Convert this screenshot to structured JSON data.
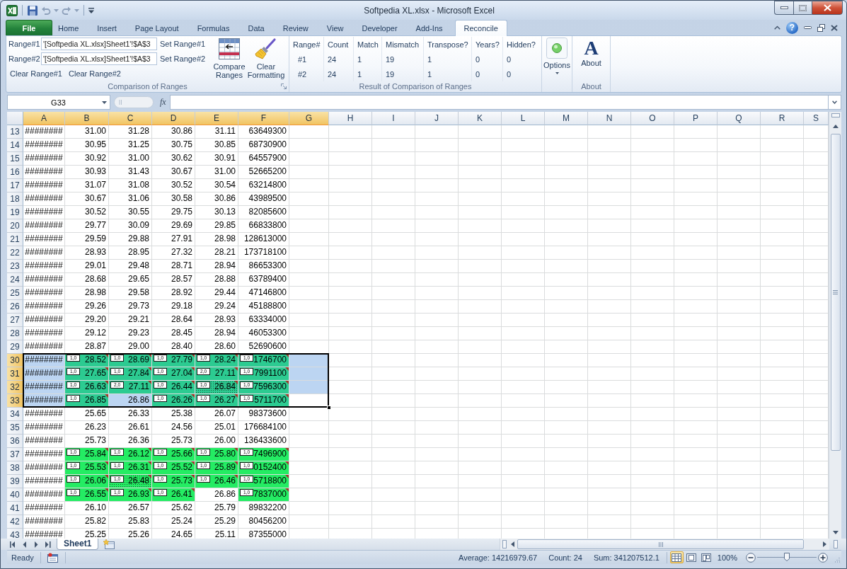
{
  "window": {
    "title": "Softpedia XL.xlsx - Microsoft Excel"
  },
  "ribbon_tabs": [
    {
      "label": "File",
      "kind": "file",
      "selected": false
    },
    {
      "label": "Home",
      "kind": "tab",
      "selected": false
    },
    {
      "label": "Insert",
      "kind": "tab",
      "selected": false
    },
    {
      "label": "Page Layout",
      "kind": "tab",
      "selected": false
    },
    {
      "label": "Formulas",
      "kind": "tab",
      "selected": false
    },
    {
      "label": "Data",
      "kind": "tab",
      "selected": false
    },
    {
      "label": "Review",
      "kind": "tab",
      "selected": false
    },
    {
      "label": "View",
      "kind": "tab",
      "selected": false
    },
    {
      "label": "Developer",
      "kind": "tab",
      "selected": false
    },
    {
      "label": "Add-Ins",
      "kind": "tab",
      "selected": false
    },
    {
      "label": "Reconcile",
      "kind": "tab",
      "selected": true
    }
  ],
  "ribbon_controls": {
    "help": "?"
  },
  "ribbon": {
    "comparison": {
      "title": "Comparison of Ranges",
      "ranges": [
        {
          "label": "Range#1",
          "value": "'[Softpedia XL.xlsx]Sheet1'!$A$3",
          "button": "Set Range#1"
        },
        {
          "label": "Range#2",
          "value": "'[Softpedia XL.xlsx]Sheet1'!$A$3",
          "button": "Set Range#2"
        }
      ],
      "clear_buttons": [
        "Clear Range#1",
        "Clear Range#2"
      ],
      "large_buttons": [
        {
          "kind": "compare",
          "label": "Compare Ranges"
        },
        {
          "kind": "clear",
          "label": "Clear Formatting"
        }
      ]
    },
    "results": {
      "title": "Result of Comparison of Ranges",
      "columns": [
        "Range#",
        "Count",
        "Match",
        "Mismatch",
        "Transpose?",
        "Years?",
        "Hidden?"
      ],
      "rows": [
        [
          "#1",
          "24",
          "1",
          "19",
          "1",
          "0",
          "0"
        ],
        [
          "#2",
          "24",
          "1",
          "19",
          "1",
          "0",
          "0"
        ]
      ]
    },
    "options": {
      "label": "Options"
    },
    "about": {
      "glyph": "A",
      "label": "About",
      "title": "About"
    }
  },
  "formula_bar": {
    "name_box": "G33",
    "function_button": "fx"
  },
  "sheet": {
    "columns": [
      {
        "label": "A",
        "selected": true
      },
      {
        "label": "B",
        "selected": true
      },
      {
        "label": "C",
        "selected": true
      },
      {
        "label": "D",
        "selected": true
      },
      {
        "label": "E",
        "selected": true
      },
      {
        "label": "F",
        "selected": true
      },
      {
        "label": "G",
        "selected": true
      },
      {
        "label": "H",
        "selected": false
      },
      {
        "label": "I",
        "selected": false
      },
      {
        "label": "J",
        "selected": false
      },
      {
        "label": "K",
        "selected": false
      },
      {
        "label": "L",
        "selected": false
      },
      {
        "label": "M",
        "selected": false
      },
      {
        "label": "N",
        "selected": false
      },
      {
        "label": "O",
        "selected": false
      },
      {
        "label": "P",
        "selected": false
      },
      {
        "label": "Q",
        "selected": false
      },
      {
        "label": "R",
        "selected": false
      },
      {
        "label": "S",
        "selected": false
      }
    ],
    "rows": [
      {
        "number": "13",
        "selected": false,
        "cells": [
          {
            "text": "########",
            "active": false,
            "dotted": false
          },
          {
            "text": "31.00",
            "active": false,
            "dotted": false
          },
          {
            "text": "31.28",
            "active": false,
            "dotted": false
          },
          {
            "text": "30.86",
            "active": false,
            "dotted": false
          },
          {
            "text": "31.11",
            "active": false,
            "dotted": false
          },
          {
            "text": "63649300",
            "active": false,
            "dotted": false
          }
        ]
      },
      {
        "number": "14",
        "selected": false,
        "cells": [
          {
            "text": "########",
            "active": false,
            "dotted": false
          },
          {
            "text": "30.95",
            "active": false,
            "dotted": false
          },
          {
            "text": "31.25",
            "active": false,
            "dotted": false
          },
          {
            "text": "30.75",
            "active": false,
            "dotted": false
          },
          {
            "text": "30.85",
            "active": false,
            "dotted": false
          },
          {
            "text": "68730900",
            "active": false,
            "dotted": false
          }
        ]
      },
      {
        "number": "15",
        "selected": false,
        "cells": [
          {
            "text": "########",
            "active": false,
            "dotted": false
          },
          {
            "text": "30.92",
            "active": false,
            "dotted": false
          },
          {
            "text": "31.00",
            "active": false,
            "dotted": false
          },
          {
            "text": "30.62",
            "active": false,
            "dotted": false
          },
          {
            "text": "30.91",
            "active": false,
            "dotted": false
          },
          {
            "text": "64557900",
            "active": false,
            "dotted": false
          }
        ]
      },
      {
        "number": "16",
        "selected": false,
        "cells": [
          {
            "text": "########",
            "active": false,
            "dotted": false
          },
          {
            "text": "30.93",
            "active": false,
            "dotted": false
          },
          {
            "text": "31.43",
            "active": false,
            "dotted": false
          },
          {
            "text": "30.67",
            "active": false,
            "dotted": false
          },
          {
            "text": "31.00",
            "active": false,
            "dotted": false
          },
          {
            "text": "52665200",
            "active": false,
            "dotted": false
          }
        ]
      },
      {
        "number": "17",
        "selected": false,
        "cells": [
          {
            "text": "########",
            "active": false,
            "dotted": false
          },
          {
            "text": "31.07",
            "active": false,
            "dotted": false
          },
          {
            "text": "31.08",
            "active": false,
            "dotted": false
          },
          {
            "text": "30.52",
            "active": false,
            "dotted": false
          },
          {
            "text": "30.54",
            "active": false,
            "dotted": false
          },
          {
            "text": "63214800",
            "active": false,
            "dotted": false
          }
        ]
      },
      {
        "number": "18",
        "selected": false,
        "cells": [
          {
            "text": "########",
            "active": false,
            "dotted": false
          },
          {
            "text": "30.67",
            "active": false,
            "dotted": false
          },
          {
            "text": "31.06",
            "active": false,
            "dotted": false
          },
          {
            "text": "30.58",
            "active": false,
            "dotted": false
          },
          {
            "text": "30.86",
            "active": false,
            "dotted": false
          },
          {
            "text": "43989500",
            "active": false,
            "dotted": false
          }
        ]
      },
      {
        "number": "19",
        "selected": false,
        "cells": [
          {
            "text": "########",
            "active": false,
            "dotted": false
          },
          {
            "text": "30.52",
            "active": false,
            "dotted": false
          },
          {
            "text": "30.55",
            "active": false,
            "dotted": false
          },
          {
            "text": "29.75",
            "active": false,
            "dotted": false
          },
          {
            "text": "30.13",
            "active": false,
            "dotted": false
          },
          {
            "text": "82085600",
            "active": false,
            "dotted": false
          }
        ]
      },
      {
        "number": "20",
        "selected": false,
        "cells": [
          {
            "text": "########",
            "active": false,
            "dotted": false
          },
          {
            "text": "29.77",
            "active": false,
            "dotted": false
          },
          {
            "text": "30.09",
            "active": false,
            "dotted": false
          },
          {
            "text": "29.69",
            "active": false,
            "dotted": false
          },
          {
            "text": "29.85",
            "active": false,
            "dotted": false
          },
          {
            "text": "66833800",
            "active": false,
            "dotted": false
          }
        ]
      },
      {
        "number": "21",
        "selected": false,
        "cells": [
          {
            "text": "########",
            "active": false,
            "dotted": false
          },
          {
            "text": "29.59",
            "active": false,
            "dotted": false
          },
          {
            "text": "29.88",
            "active": false,
            "dotted": false
          },
          {
            "text": "27.91",
            "active": false,
            "dotted": false
          },
          {
            "text": "28.98",
            "active": false,
            "dotted": false
          },
          {
            "text": "128613000",
            "active": false,
            "dotted": false
          }
        ]
      },
      {
        "number": "22",
        "selected": false,
        "cells": [
          {
            "text": "########",
            "active": false,
            "dotted": false
          },
          {
            "text": "28.93",
            "active": false,
            "dotted": false
          },
          {
            "text": "28.95",
            "active": false,
            "dotted": false
          },
          {
            "text": "27.32",
            "active": false,
            "dotted": false
          },
          {
            "text": "28.21",
            "active": false,
            "dotted": false
          },
          {
            "text": "173718100",
            "active": false,
            "dotted": false
          }
        ]
      },
      {
        "number": "23",
        "selected": false,
        "cells": [
          {
            "text": "########",
            "active": false,
            "dotted": false
          },
          {
            "text": "29.01",
            "active": false,
            "dotted": false
          },
          {
            "text": "29.48",
            "active": false,
            "dotted": false
          },
          {
            "text": "28.71",
            "active": false,
            "dotted": false
          },
          {
            "text": "28.94",
            "active": false,
            "dotted": false
          },
          {
            "text": "86653300",
            "active": false,
            "dotted": false
          }
        ]
      },
      {
        "number": "24",
        "selected": false,
        "cells": [
          {
            "text": "########",
            "active": false,
            "dotted": false
          },
          {
            "text": "28.68",
            "active": false,
            "dotted": false
          },
          {
            "text": "29.65",
            "active": false,
            "dotted": false
          },
          {
            "text": "28.57",
            "active": false,
            "dotted": false
          },
          {
            "text": "28.88",
            "active": false,
            "dotted": false
          },
          {
            "text": "63789400",
            "active": false,
            "dotted": false
          }
        ]
      },
      {
        "number": "25",
        "selected": false,
        "cells": [
          {
            "text": "########",
            "active": false,
            "dotted": false
          },
          {
            "text": "28.98",
            "active": false,
            "dotted": false
          },
          {
            "text": "29.58",
            "active": false,
            "dotted": false
          },
          {
            "text": "28.92",
            "active": false,
            "dotted": false
          },
          {
            "text": "29.44",
            "active": false,
            "dotted": false
          },
          {
            "text": "47146800",
            "active": false,
            "dotted": false
          }
        ]
      },
      {
        "number": "26",
        "selected": false,
        "cells": [
          {
            "text": "########",
            "active": false,
            "dotted": false
          },
          {
            "text": "29.26",
            "active": false,
            "dotted": false
          },
          {
            "text": "29.73",
            "active": false,
            "dotted": false
          },
          {
            "text": "29.18",
            "active": false,
            "dotted": false
          },
          {
            "text": "29.24",
            "active": false,
            "dotted": false
          },
          {
            "text": "45188800",
            "active": false,
            "dotted": false
          }
        ]
      },
      {
        "number": "27",
        "selected": false,
        "cells": [
          {
            "text": "########",
            "active": false,
            "dotted": false
          },
          {
            "text": "29.20",
            "active": false,
            "dotted": false
          },
          {
            "text": "29.21",
            "active": false,
            "dotted": false
          },
          {
            "text": "28.64",
            "active": false,
            "dotted": false
          },
          {
            "text": "28.93",
            "active": false,
            "dotted": false
          },
          {
            "text": "63334000",
            "active": false,
            "dotted": false
          }
        ]
      },
      {
        "number": "28",
        "selected": false,
        "cells": [
          {
            "text": "########",
            "active": false,
            "dotted": false
          },
          {
            "text": "29.12",
            "active": false,
            "dotted": false
          },
          {
            "text": "29.23",
            "active": false,
            "dotted": false
          },
          {
            "text": "28.45",
            "active": false,
            "dotted": false
          },
          {
            "text": "28.94",
            "active": false,
            "dotted": false
          },
          {
            "text": "46053300",
            "active": false,
            "dotted": false
          }
        ]
      },
      {
        "number": "29",
        "selected": false,
        "cells": [
          {
            "text": "########",
            "active": false,
            "dotted": false
          },
          {
            "text": "28.87",
            "active": false,
            "dotted": false
          },
          {
            "text": "29.00",
            "active": false,
            "dotted": false
          },
          {
            "text": "28.40",
            "active": false,
            "dotted": false
          },
          {
            "text": "28.60",
            "active": false,
            "dotted": false
          },
          {
            "text": "52690600",
            "active": false,
            "dotted": false
          }
        ]
      },
      {
        "number": "30",
        "selected": true,
        "cells": [
          {
            "text": "########",
            "active": false,
            "dotted": false
          },
          {
            "text": "28.52",
            "active": false,
            "dotted": false,
            "color": "#2ccb91",
            "note": "1,0"
          },
          {
            "text": "28.69",
            "active": false,
            "dotted": false,
            "color": "#2ccb91",
            "note": "1,0"
          },
          {
            "text": "27.79",
            "active": false,
            "dotted": false,
            "color": "#2ccb91",
            "note": "1,0"
          },
          {
            "text": "28.24",
            "active": false,
            "dotted": false,
            "color": "#2ccb91",
            "note": "1,0"
          },
          {
            "text": "1746700",
            "active": false,
            "dotted": false,
            "color": "#2ccb91",
            "note": "1,0"
          },
          {
            "active": false,
            "dotted": false
          }
        ]
      },
      {
        "number": "31",
        "selected": true,
        "cells": [
          {
            "text": "########",
            "active": false,
            "dotted": false
          },
          {
            "text": "27.65",
            "active": false,
            "dotted": false,
            "color": "#2ccb91",
            "note": "1,0"
          },
          {
            "text": "27.84",
            "active": false,
            "dotted": false,
            "color": "#2ccb91",
            "note": "1,0"
          },
          {
            "text": "27.04",
            "active": false,
            "dotted": false,
            "color": "#2ccb91",
            "note": "1,0"
          },
          {
            "text": "27.11",
            "active": false,
            "dotted": false,
            "color": "#2ccb91",
            "note": "2,0"
          },
          {
            "text": "7991100",
            "active": false,
            "dotted": false,
            "color": "#2ccb91",
            "note": "1,0"
          },
          {
            "active": false,
            "dotted": false
          }
        ]
      },
      {
        "number": "32",
        "selected": true,
        "cells": [
          {
            "text": "########",
            "active": false,
            "dotted": false
          },
          {
            "text": "26.63",
            "active": false,
            "dotted": false,
            "color": "#2ccb91",
            "note": "1,0"
          },
          {
            "text": "27.11",
            "active": false,
            "dotted": false,
            "color": "#2ccb91",
            "note": "2,0"
          },
          {
            "text": "26.44",
            "active": false,
            "dotted": false,
            "color": "#2ccb91",
            "note": "1,0"
          },
          {
            "text": "26.84",
            "active": false,
            "dotted": true,
            "color": "#2ccb91",
            "note": "1,0"
          },
          {
            "text": "7596300",
            "active": false,
            "dotted": false,
            "color": "#2ccb91",
            "note": "1,0"
          },
          {
            "active": false,
            "dotted": false
          }
        ]
      },
      {
        "number": "33",
        "selected": true,
        "cells": [
          {
            "text": "########",
            "active": false,
            "dotted": false
          },
          {
            "text": "26.85",
            "active": false,
            "dotted": false,
            "color": "#2ccb91",
            "note": "1,0"
          },
          {
            "text": "26.86",
            "active": false,
            "dotted": false
          },
          {
            "text": "26.26",
            "active": false,
            "dotted": false,
            "color": "#2ccb91",
            "note": "1,0"
          },
          {
            "text": "26.27",
            "active": false,
            "dotted": false,
            "color": "#2ccb91",
            "note": "1,0"
          },
          {
            "text": "5711700",
            "active": false,
            "dotted": false,
            "color": "#2ccb91",
            "note": "1,0"
          },
          {
            "active": true,
            "dotted": false
          }
        ]
      },
      {
        "number": "34",
        "selected": false,
        "cells": [
          {
            "text": "########",
            "active": false,
            "dotted": false
          },
          {
            "text": "25.65",
            "active": false,
            "dotted": false
          },
          {
            "text": "26.33",
            "active": false,
            "dotted": false
          },
          {
            "text": "25.38",
            "active": false,
            "dotted": false
          },
          {
            "text": "26.07",
            "active": false,
            "dotted": false
          },
          {
            "text": "98373600",
            "active": false,
            "dotted": false
          }
        ]
      },
      {
        "number": "35",
        "selected": false,
        "cells": [
          {
            "text": "########",
            "active": false,
            "dotted": false
          },
          {
            "text": "26.23",
            "active": false,
            "dotted": false
          },
          {
            "text": "26.61",
            "active": false,
            "dotted": false
          },
          {
            "text": "24.56",
            "active": false,
            "dotted": false
          },
          {
            "text": "25.01",
            "active": false,
            "dotted": false
          },
          {
            "text": "176684100",
            "active": false,
            "dotted": false
          }
        ]
      },
      {
        "number": "36",
        "selected": false,
        "cells": [
          {
            "text": "########",
            "active": false,
            "dotted": false
          },
          {
            "text": "25.73",
            "active": false,
            "dotted": false
          },
          {
            "text": "26.36",
            "active": false,
            "dotted": false
          },
          {
            "text": "25.73",
            "active": false,
            "dotted": false
          },
          {
            "text": "26.00",
            "active": false,
            "dotted": false
          },
          {
            "text": "136433600",
            "active": false,
            "dotted": false
          }
        ]
      },
      {
        "number": "37",
        "selected": false,
        "cells": [
          {
            "text": "########",
            "active": false,
            "dotted": false
          },
          {
            "text": "25.84",
            "active": false,
            "dotted": false,
            "color": "#24ec63",
            "note": "1,0"
          },
          {
            "text": "26.12",
            "active": false,
            "dotted": false,
            "color": "#24ec63",
            "note": "1,0"
          },
          {
            "text": "25.66",
            "active": false,
            "dotted": false,
            "color": "#24ec63",
            "note": "1,0"
          },
          {
            "text": "25.80",
            "active": false,
            "dotted": false,
            "color": "#24ec63",
            "note": "1,0"
          },
          {
            "text": "7496900",
            "active": false,
            "dotted": false,
            "color": "#24ec63",
            "note": "1,0"
          }
        ]
      },
      {
        "number": "38",
        "selected": false,
        "cells": [
          {
            "text": "########",
            "active": false,
            "dotted": false
          },
          {
            "text": "25.53",
            "active": false,
            "dotted": false,
            "color": "#24ec63",
            "note": "1,0"
          },
          {
            "text": "26.31",
            "active": false,
            "dotted": false,
            "color": "#24ec63",
            "note": "1,0"
          },
          {
            "text": "25.52",
            "active": false,
            "dotted": false,
            "color": "#24ec63",
            "note": "1,0"
          },
          {
            "text": "25.89",
            "active": false,
            "dotted": false,
            "color": "#24ec63",
            "note": "1,0"
          },
          {
            "text": "0152400",
            "active": false,
            "dotted": false,
            "color": "#24ec63",
            "note": "1,0"
          }
        ]
      },
      {
        "number": "39",
        "selected": false,
        "cells": [
          {
            "text": "########",
            "active": false,
            "dotted": false
          },
          {
            "text": "26.06",
            "active": false,
            "dotted": false,
            "color": "#24ec63",
            "note": "1,0"
          },
          {
            "text": "26.48",
            "active": false,
            "dotted": true,
            "color": "#24ec63",
            "note": "1,0"
          },
          {
            "text": "25.73",
            "active": false,
            "dotted": false,
            "color": "#24ec63",
            "note": "1,0"
          },
          {
            "text": "26.46",
            "active": false,
            "dotted": false,
            "color": "#24ec63",
            "note": "1,0"
          },
          {
            "text": "5718800",
            "active": false,
            "dotted": false,
            "color": "#24ec63",
            "note": "1,0"
          }
        ]
      },
      {
        "number": "40",
        "selected": false,
        "cells": [
          {
            "text": "########",
            "active": false,
            "dotted": false
          },
          {
            "text": "26.55",
            "active": false,
            "dotted": false,
            "color": "#24ec63",
            "note": "1,0"
          },
          {
            "text": "26.93",
            "active": false,
            "dotted": false,
            "color": "#24ec63",
            "note": "1,0"
          },
          {
            "text": "26.41",
            "active": false,
            "dotted": false,
            "color": "#24ec63",
            "note": "1,0"
          },
          {
            "text": "26.86",
            "active": false,
            "dotted": false
          },
          {
            "text": "7837000",
            "active": false,
            "dotted": false,
            "color": "#24ec63",
            "note": "1,0"
          }
        ]
      },
      {
        "number": "41",
        "selected": false,
        "cells": [
          {
            "text": "########",
            "active": false,
            "dotted": false
          },
          {
            "text": "26.10",
            "active": false,
            "dotted": false
          },
          {
            "text": "26.57",
            "active": false,
            "dotted": false
          },
          {
            "text": "25.62",
            "active": false,
            "dotted": false
          },
          {
            "text": "25.79",
            "active": false,
            "dotted": false
          },
          {
            "text": "89832200",
            "active": false,
            "dotted": false
          }
        ]
      },
      {
        "number": "42",
        "selected": false,
        "cells": [
          {
            "text": "########",
            "active": false,
            "dotted": false
          },
          {
            "text": "25.82",
            "active": false,
            "dotted": false
          },
          {
            "text": "25.83",
            "active": false,
            "dotted": false
          },
          {
            "text": "25.24",
            "active": false,
            "dotted": false
          },
          {
            "text": "25.29",
            "active": false,
            "dotted": false
          },
          {
            "text": "80456200",
            "active": false,
            "dotted": false
          }
        ]
      },
      {
        "number": "43",
        "selected": false,
        "cells": [
          {
            "text": "########",
            "active": false,
            "dotted": false
          },
          {
            "text": "25.25",
            "active": false,
            "dotted": false
          },
          {
            "text": "25.26",
            "active": false,
            "dotted": false
          },
          {
            "text": "24.65",
            "active": false,
            "dotted": false
          },
          {
            "text": "25.11",
            "active": false,
            "dotted": false
          },
          {
            "text": "87355000",
            "active": false,
            "dotted": false
          }
        ]
      }
    ]
  },
  "sheet_tabs": [
    {
      "label": "Sheet1",
      "selected": true
    }
  ],
  "status_bar": {
    "mode": "Ready",
    "average": "Average: 14216979.67",
    "count": "Count: 24",
    "sum": "Sum: 341207512.1",
    "views": [
      {
        "kind": "normal",
        "selected": true
      },
      {
        "kind": "page_layout",
        "selected": false
      },
      {
        "kind": "page_break",
        "selected": false
      }
    ],
    "zoom": "100%",
    "zoom_slider": {
      "level": 0.5
    }
  }
}
